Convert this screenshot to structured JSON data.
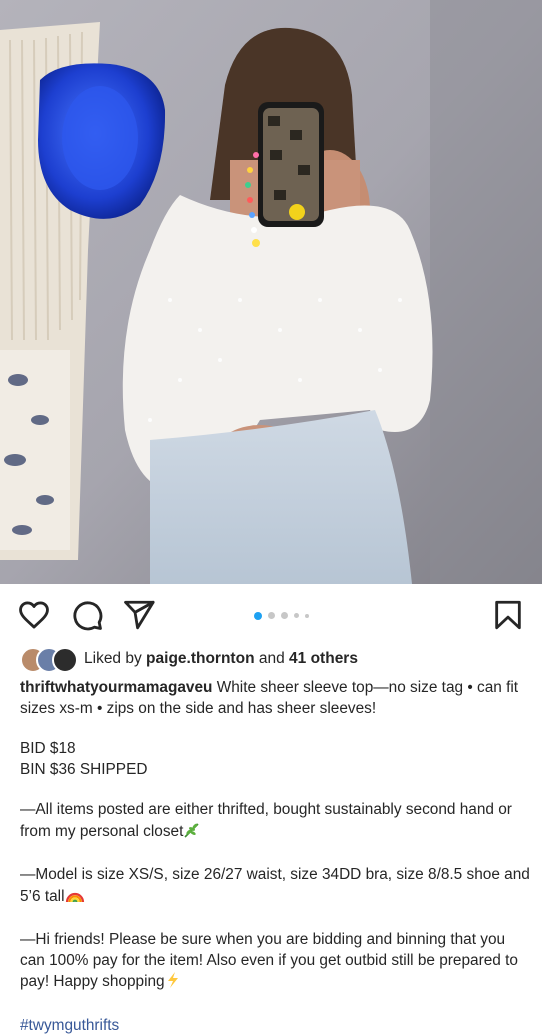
{
  "post": {
    "image_alt": "Photo of woman in white sheer sleeve top taking mirror selfie",
    "carousel": {
      "count": 5,
      "active_index": 0
    },
    "likes": {
      "prefix": "Liked by",
      "user": "paige.thornton",
      "middle": "and",
      "others": "41 others"
    },
    "caption": {
      "username": "thriftwhatyourmamagaveu",
      "line1": "White sheer sleeve top—no size tag • can fit sizes xs-m • zips on the side and has sheer sleeves!",
      "bid": "BID $18",
      "bin": "BIN $36 SHIPPED",
      "para2": "—All items posted are either thrifted, bought sustainably second hand or from my personal closet",
      "para3": "—Model is size XS/S, size 26/27 waist, size 34DD bra, size 8/8.5 shoe and 5’6 tall",
      "para4": "—Hi friends! Please be sure when you are bidding and binning that you can 100% pay for the item! Also even if you get outbid still be prepared to pay! Happy shopping",
      "hashtag": "#twymguthrifts"
    },
    "icons": {
      "like": "heart-icon",
      "comment": "comment-icon",
      "share": "paper-plane-icon",
      "save": "bookmark-icon",
      "leaf": "herb-emoji",
      "rainbow": "rainbow-emoji",
      "bolt": "lightning-emoji"
    },
    "colors": {
      "accent_dot": "#1da1f2",
      "hashtag": "#385898"
    }
  }
}
